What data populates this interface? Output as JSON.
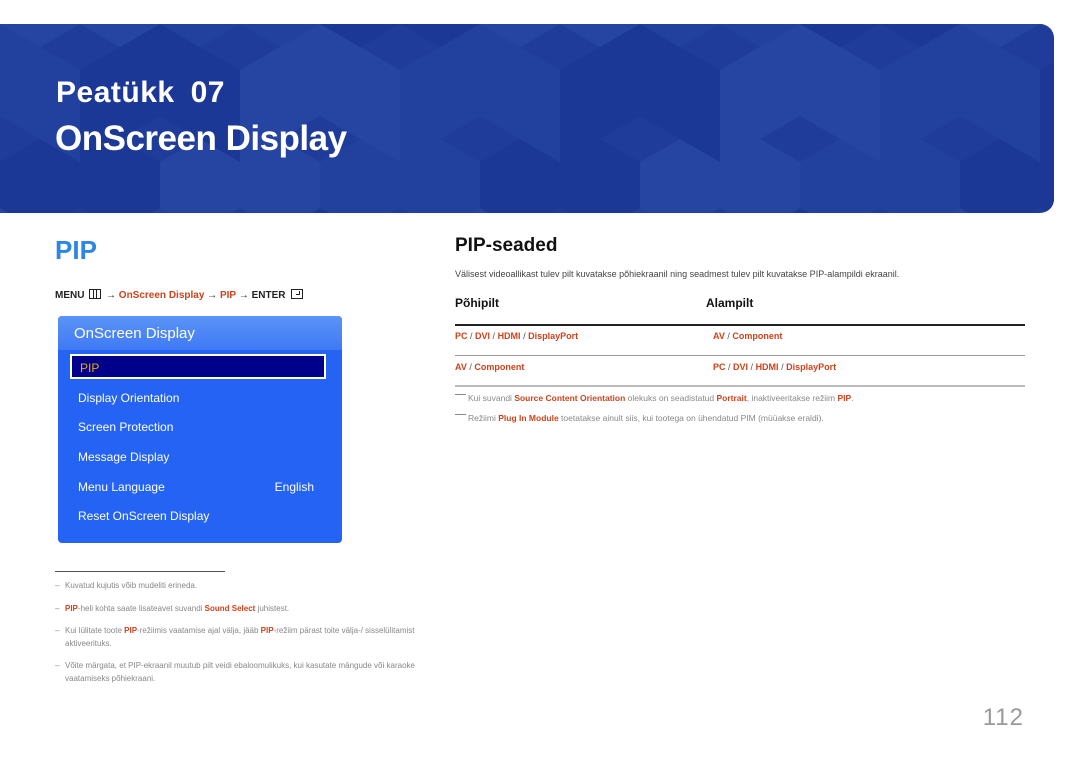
{
  "banner": {
    "chapter_label": "Peatükk",
    "chapter_number": "07",
    "title": "OnScreen Display",
    "color": "#1f3c9a"
  },
  "left": {
    "heading": "PIP",
    "menu_path": {
      "menu": "MENU",
      "arrow": "→",
      "step1": "OnScreen Display",
      "step2": "PIP",
      "enter": "ENTER"
    },
    "osd": {
      "title": "OnScreen Display",
      "items": [
        {
          "label": "PIP",
          "value": "",
          "selected": true
        },
        {
          "label": "Display Orientation",
          "value": ""
        },
        {
          "label": "Screen Protection",
          "value": ""
        },
        {
          "label": "Message Display",
          "value": ""
        },
        {
          "label": "Menu Language",
          "value": "English"
        },
        {
          "label": "Reset OnScreen Display",
          "value": ""
        }
      ]
    },
    "notes": [
      {
        "parts": [
          "Kuvatud kujutis võib mudeliti erineda."
        ]
      },
      {
        "b1": "PIP",
        "t1": "-heli kohta saate lisateavet suvandi ",
        "b2": "Sound Select",
        "t2": " juhistest."
      },
      {
        "t0": "Kui lülitate toote ",
        "b1": "PIP",
        "t1": "-režiimis vaatamise ajal välja, jääb ",
        "b2": "PIP",
        "t2": "-režiim pärast toite välja-/ sisselülitamist aktiveerituks."
      },
      {
        "parts": [
          "Võite märgata, et PIP-ekraanil muutub pilt veidi ebaloomulikuks, kui kasutate mängude või karaoke vaatamiseks põhiekraani."
        ]
      }
    ],
    "dash": "–"
  },
  "right": {
    "heading": "PIP-seaded",
    "intro": "Välisest videoallikast tulev pilt kuvatakse põhiekraanil ning seadmest tulev pilt kuvatakse PIP-alampildi ekraanil.",
    "table": {
      "headers": [
        "Põhipilt",
        "Alampilt"
      ],
      "rows": [
        [
          [
            "PC",
            "DVI",
            "HDMI",
            "DisplayPort"
          ],
          [
            "AV",
            "Component"
          ]
        ],
        [
          [
            "AV",
            "Component"
          ],
          [
            "PC",
            "DVI",
            "HDMI",
            "DisplayPort"
          ]
        ]
      ],
      "separator": " / "
    },
    "notes": [
      {
        "t0": "Kui suvandi ",
        "b1": "Source Content Orientation",
        "t1": " olekuks on seadistatud ",
        "b2": "Portrait",
        "t2": ", inaktiveeritakse režiim ",
        "b3": "PIP",
        "t3": "."
      },
      {
        "t0": "Režiimi ",
        "b1": "Plug In Module",
        "t1": " toetatakse ainult siis, kui tootega on ühendatud PIM (müüakse eraldi)."
      }
    ]
  },
  "page_number": "112",
  "colors": {
    "accent_blue": "#2b86e6",
    "highlight_red": "#d0421a",
    "osd_blue": "#2563f5",
    "osd_selected": "#00008a",
    "osd_selected_text": "#f2a900"
  }
}
